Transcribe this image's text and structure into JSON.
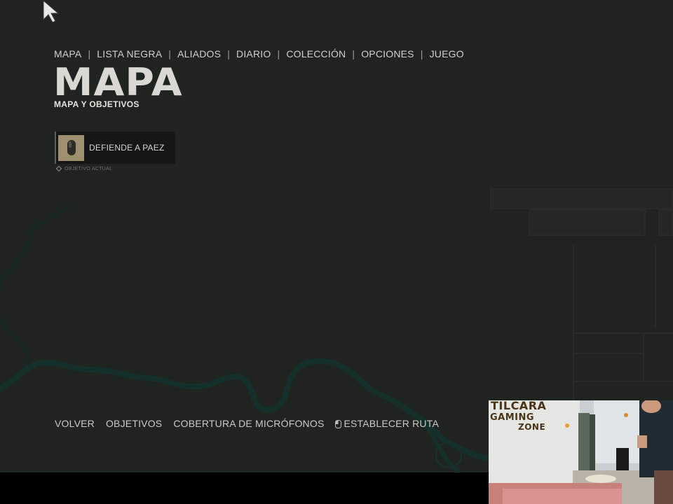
{
  "nav": {
    "items": [
      "MAPA",
      "LISTA NEGRA",
      "ALIADOS",
      "DIARIO",
      "COLECCIÓN",
      "OPCIONES",
      "JUEGO"
    ],
    "separator": "|"
  },
  "header": {
    "title": "MAPA",
    "subtitle": "MAPA Y OBJETIVOS"
  },
  "objective": {
    "label": "DEFIENDE A PAEZ",
    "status": "OBJETIVO ACTUAL",
    "icon": "grenade-icon"
  },
  "actions": {
    "back": "VOLVER",
    "objectives": "OBJETIVOS",
    "mic_coverage": "COBERTURA DE MICRÓFONOS",
    "set_route": "ESTABLECER RUTA"
  },
  "webcam": {
    "sign_line_1": "TILCARA",
    "sign_line_2": "GAMING",
    "sign_line_3": "ZONE"
  },
  "colors": {
    "map_background": "#1f2421",
    "river": "#17322d",
    "text": "#cfd1cc",
    "objective_thumb": "#a08f6e"
  }
}
